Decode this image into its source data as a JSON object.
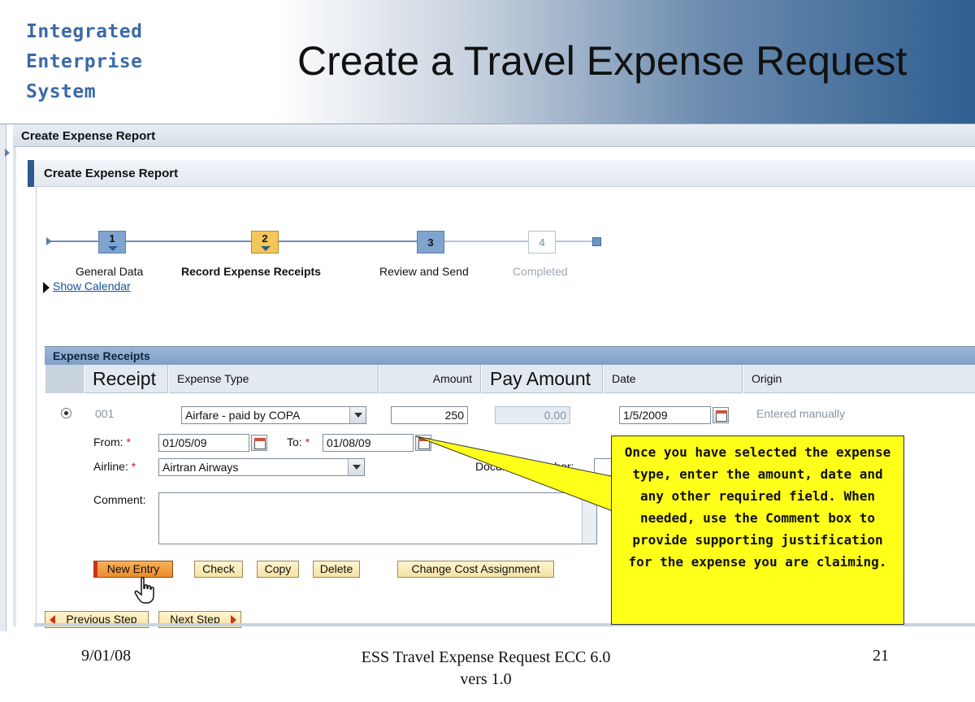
{
  "slide": {
    "brand_lines": [
      "Integrated",
      "Enterprise",
      "System"
    ],
    "title": "Create a Travel Expense Request"
  },
  "outer_panel": {
    "title": "Create Expense Report"
  },
  "inner_panel": {
    "title": "Create Expense Report"
  },
  "roadmap": {
    "steps": [
      {
        "number": "1",
        "label": "General Data",
        "state": "visited"
      },
      {
        "number": "2",
        "label": "Record Expense Receipts",
        "state": "current"
      },
      {
        "number": "3",
        "label": "Review and Send",
        "state": "pending"
      },
      {
        "number": "4",
        "label": "Completed",
        "state": "disabled"
      }
    ]
  },
  "show_calendar": {
    "label": "Show Calendar"
  },
  "receipts": {
    "title": "Expense Receipts",
    "columns": [
      "Receipt",
      "Expense Type",
      "Amount",
      "Pay Amount",
      "Date",
      "Origin"
    ],
    "row": {
      "receipt": "001",
      "expense_type": "Airfare - paid by COPA",
      "amount": "250",
      "pay_amount": "0.00",
      "date": "1/5/2009",
      "origin": "Entered manually"
    },
    "detail": {
      "from_label": "From:",
      "from_value": "01/05/09",
      "to_label": "To:",
      "to_value": "01/08/09",
      "airline_label": "Airline:",
      "airline_value": "Airtran Airways",
      "document_number_label": "Document Number:",
      "document_number_value": "",
      "comment_label": "Comment:",
      "comment_value": "",
      "required_marker": "*"
    }
  },
  "actions": {
    "new_entry": "New Entry",
    "check": "Check",
    "copy": "Copy",
    "delete": "Delete",
    "change_cost_assignment": "Change Cost Assignment",
    "previous_step": "Previous Step",
    "next_step": "Next Step"
  },
  "callout": {
    "text": "Once you have selected the expense type, enter the amount, date and any other required field.  When needed, use the Comment box to provide supporting justification for the expense you are claiming."
  },
  "footer": {
    "date": "9/01/08",
    "center_line1": "ESS Travel Expense Request ECC 6.0",
    "center_line2": "vers 1.0",
    "page": "21"
  },
  "colors": {
    "callout_background": "#ffff1a",
    "brand_text": "#3a6aa6",
    "header_gradient_end": "#2f5f90",
    "section_header": "#8fb0d4",
    "current_step": "#f4c659",
    "new_entry_button": "#ee8a2d"
  }
}
